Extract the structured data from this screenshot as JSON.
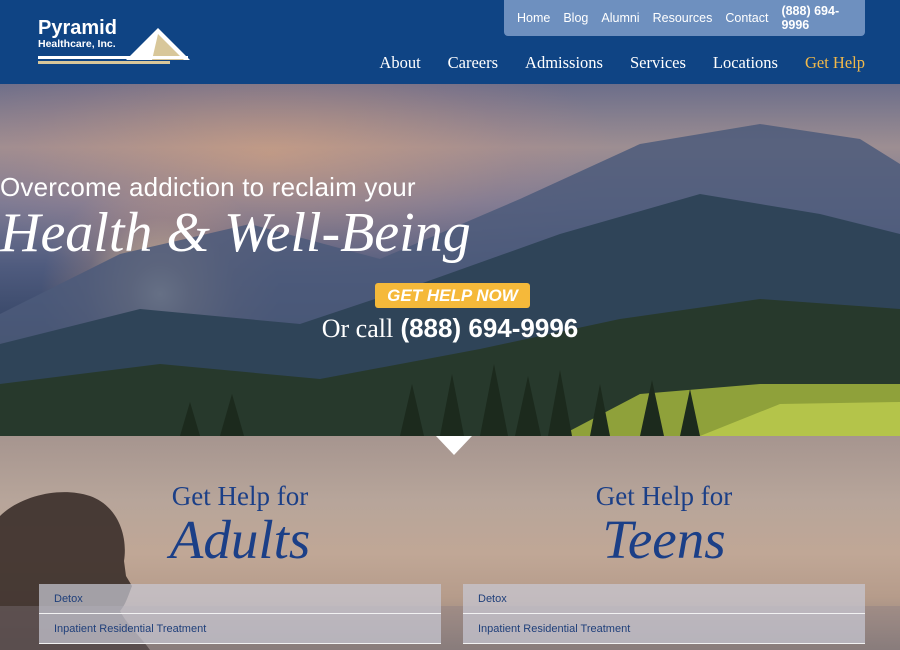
{
  "logo": {
    "name": "Pyramid",
    "subtitle": "Healthcare, Inc."
  },
  "utility_nav": {
    "items": [
      "Home",
      "Blog",
      "Alumni",
      "Resources",
      "Contact"
    ],
    "phone": "(888) 694-9996"
  },
  "main_nav": {
    "items": [
      "About",
      "Careers",
      "Admissions",
      "Services",
      "Locations"
    ],
    "cta": "Get Help"
  },
  "hero": {
    "line1": "Overcome addiction to reclaim your",
    "line2": "Health & Well-Being",
    "cta_label": "GET HELP NOW",
    "call_prefix": "Or call",
    "call_number": "(888) 694-9996"
  },
  "sections": {
    "adults": {
      "title_top": "Get Help for",
      "title_bottom": "Adults",
      "items": [
        "Detox",
        "Inpatient Residential Treatment"
      ]
    },
    "teens": {
      "title_top": "Get Help for",
      "title_bottom": "Teens",
      "items": [
        "Detox",
        "Inpatient Residential Treatment"
      ]
    }
  },
  "colors": {
    "header_bg": "#0f4484",
    "utility_bg": "#6e90bf",
    "accent_gold": "#f2b94a",
    "cta_bg": "#f5b93a",
    "title_blue": "#1b3f87"
  }
}
